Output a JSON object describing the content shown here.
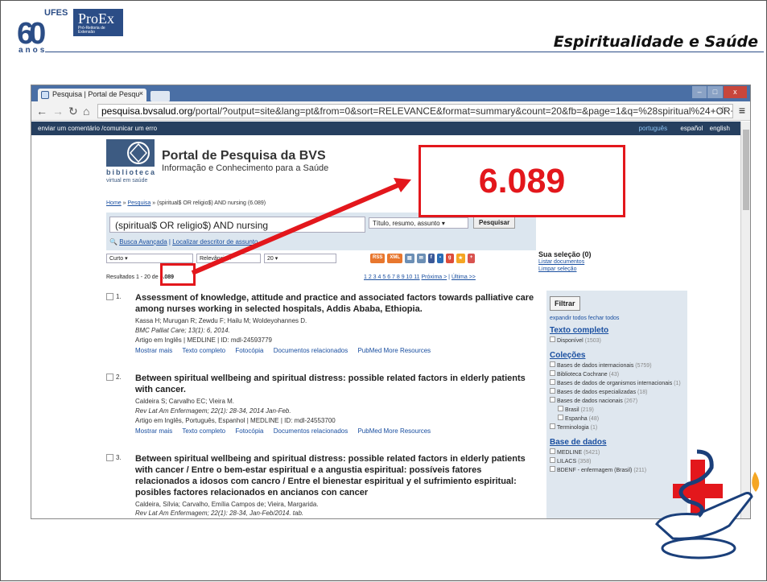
{
  "header": {
    "logo_number": "60",
    "logo_ufes": "UFES",
    "logo_proex": "ProEx",
    "logo_sub": "Pró-Reitoria de Extensão",
    "logo_anos": "anos",
    "title": "Espiritualidade e Saúde"
  },
  "browser": {
    "tab_title": "Pesquisa | Portal de Pesqu",
    "tab_close": "×",
    "url_host": "pesquisa.bvsalud.org",
    "url_path": "/portal/?output=site&lang=pt&from=0&sort=RELEVANCE&format=summary&count=20&fb=&page=1&q=%28spiritual%24+OR+",
    "window_buttons": [
      "–",
      "□",
      "x"
    ]
  },
  "site": {
    "feedback": "enviar um comentário /comunicar um erro",
    "languages": [
      "português",
      "español",
      "english"
    ],
    "logo_text": "biblioteca",
    "logo_sub": "virtual em saúde",
    "logo_short": "bvs",
    "portal_title": "Portal de Pesquisa da BVS",
    "portal_subtitle": "Informação e Conhecimento para a Saúde",
    "breadcrumb": [
      "Home",
      "Pesquisa",
      "(spiritual$ OR religio$) AND nursing (6.089)"
    ],
    "query": "(spiritual$ OR religio$) AND nursing",
    "field_select": "Título, resumo, assunto",
    "search_button": "Pesquisar",
    "advanced_search": "Busca Avançada",
    "descriptor_search": "Localizar descritor de assunto",
    "format_select": "Curto",
    "sort_select": "Relevância",
    "count_select": "20",
    "feeds": [
      "RSS",
      "XML"
    ],
    "results_prefix": "Resultados 1 - 20 de",
    "results_total": "6.089",
    "pager_pages": "1 2 3 4 5 6 7 8 9 10 11",
    "pager_next": "Próxima >",
    "pager_last": "Última >>"
  },
  "results": [
    {
      "num": "1.",
      "title": "Assessment of knowledge, attitude and practice and associated factors towards palliative care among nurses working in selected hospitals, Addis Ababa, Ethiopia.",
      "authors": "Kassa H; Murugan R; Zewdu F; Hailu M; Woldeyohannes D.",
      "source": "BMC Palliat Care; 13(1): 6, 2014.",
      "info": "Artigo em Inglês | MEDLINE | ID: mdl-24593779"
    },
    {
      "num": "2.",
      "title": "Between spiritual wellbeing and spiritual distress: possible related factors in elderly patients with cancer.",
      "authors": "Caldeira S; Carvalho EC; Vieira M.",
      "source": "Rev Lat Am Enfermagem; 22(1): 28-34, 2014 Jan-Feb.",
      "info": "Artigo em Inglês, Português, Espanhol | MEDLINE | ID: mdl-24553700"
    },
    {
      "num": "3.",
      "title": "Between spiritual wellbeing and spiritual distress: possible related factors in elderly patients with cancer / Entre o bem-estar espiritual e a angustia espiritual: possíveis fatores relacionados a idosos com cancro / Entre el bienestar espiritual y el sufrimiento espiritual: posibles factores relacionados en ancianos con cancer",
      "authors": "Caldeira, Sílvia; Carvalho, Emília Campos de; Vieira, Margarida.",
      "source": "Rev Lat Am Enfermagem; 22(1): 28-34, Jan-Feb/2014. tab."
    }
  ],
  "actions": [
    "Mostrar mais",
    "Texto completo",
    "Fotocópia",
    "Documentos relacionados",
    "PubMed More Resources"
  ],
  "sidebar": {
    "selection": "Sua seleção (0)",
    "list_docs": "Listar documentos",
    "clear": "Limpar seleção",
    "filter_button": "Filtrar",
    "expand_all": "expandir todos",
    "close_all": "fechar todos",
    "full_text": "Texto completo",
    "available": "Disponível",
    "available_count": "(1503)",
    "collections": "Coleções",
    "coll_items": [
      {
        "label": "Bases de dados internacionais",
        "count": "(5759)"
      },
      {
        "label": "Biblioteca Cochrane",
        "count": "(43)"
      },
      {
        "label": "Bases de dados de organismos internacionais",
        "count": "(1)"
      },
      {
        "label": "Bases de dados especializadas",
        "count": "(18)"
      },
      {
        "label": "Bases de dados nacionais",
        "count": "(267)"
      },
      {
        "label": "Brasil",
        "count": "(219)"
      },
      {
        "label": "Espanha",
        "count": "(48)"
      },
      {
        "label": "Terminologia",
        "count": "(1)"
      }
    ],
    "databases": "Base de dados",
    "db_items": [
      {
        "label": "MEDLINE",
        "count": "(5421)"
      },
      {
        "label": "LILACS",
        "count": "(358)"
      },
      {
        "label": "BDENF - enfermagem (Brasil)",
        "count": "(211)"
      }
    ]
  },
  "callout": {
    "value": "6.089",
    "color": "#e3171c"
  }
}
